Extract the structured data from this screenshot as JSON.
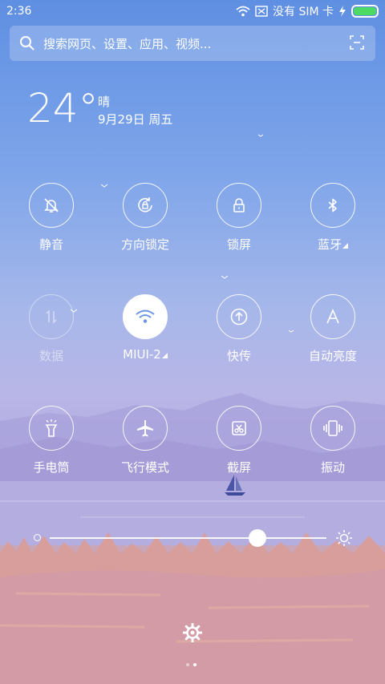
{
  "status": {
    "time": "2:36",
    "sim": "没有 SIM 卡"
  },
  "search": {
    "placeholder": "搜索网页、设置、应用、视频..."
  },
  "weather": {
    "temperature": "24°",
    "condition": "晴",
    "date": "9月29日 周五"
  },
  "toggles": [
    {
      "label": "静音",
      "icon": "bell-off-icon",
      "state": "off"
    },
    {
      "label": "方向锁定",
      "icon": "rotation-lock-icon",
      "state": "off"
    },
    {
      "label": "锁屏",
      "icon": "lock-icon",
      "state": "off"
    },
    {
      "label": "蓝牙",
      "icon": "bluetooth-icon",
      "state": "off"
    },
    {
      "label": "数据",
      "icon": "data-arrows-icon",
      "state": "disabled"
    },
    {
      "label": "MIUI-2",
      "icon": "wifi-icon",
      "state": "on"
    },
    {
      "label": "快传",
      "icon": "upload-icon",
      "state": "off"
    },
    {
      "label": "自动亮度",
      "icon": "letter-a-icon",
      "state": "off"
    },
    {
      "label": "手电筒",
      "icon": "flashlight-icon",
      "state": "off"
    },
    {
      "label": "飞行模式",
      "icon": "airplane-icon",
      "state": "off"
    },
    {
      "label": "截屏",
      "icon": "scissors-icon",
      "state": "off"
    },
    {
      "label": "振动",
      "icon": "vibrate-icon",
      "state": "off"
    }
  ],
  "brightness": {
    "level": 0.75
  },
  "pager": {
    "pages": 2,
    "current": 2
  },
  "colors": {
    "active_tile": "#ffffff",
    "battery": "#4cd964"
  }
}
